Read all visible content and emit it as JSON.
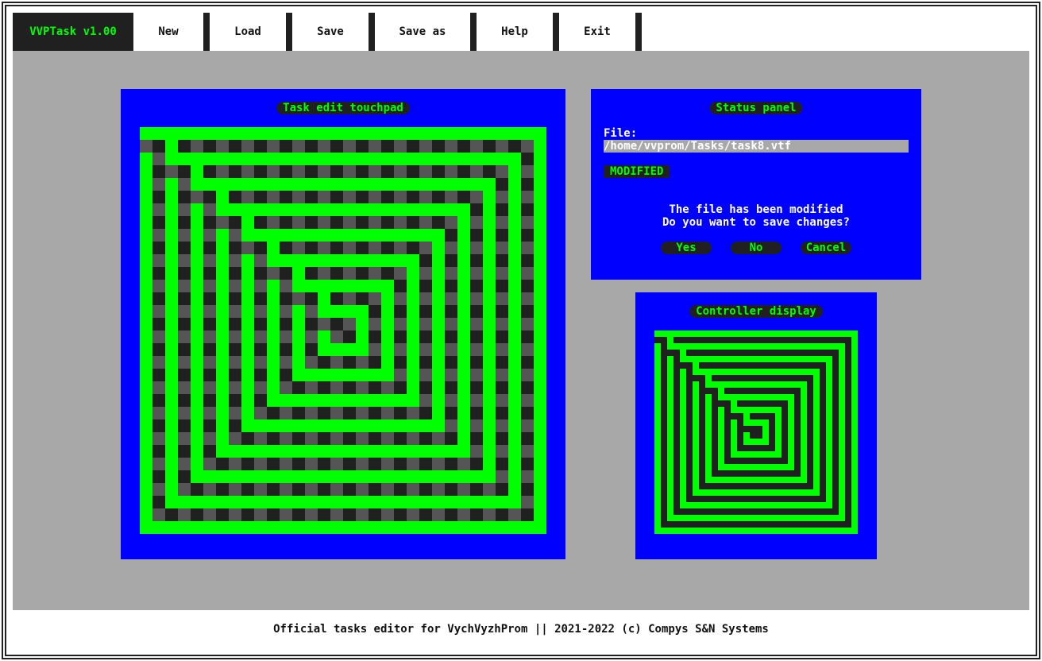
{
  "app": {
    "title": "VVPTask v1.00"
  },
  "menu": {
    "items": [
      "New",
      "Load",
      "Save",
      "Save as",
      "Help",
      "Exit"
    ]
  },
  "editor_panel": {
    "title": "Task edit touchpad"
  },
  "status_panel": {
    "title": "Status panel",
    "file_label": "File:",
    "file_path": "/home/vvprom/Tasks/task8.vtf",
    "state_badge": "MODIFIED",
    "message_line1": "The file has been modified",
    "message_line2": "Do you want to save changes?",
    "buttons": {
      "yes": "Yes",
      "no": "No",
      "cancel": "Cancel"
    }
  },
  "controller_panel": {
    "title": "Controller display"
  },
  "footer": {
    "text": "Official tasks editor for VychVyzhProm || 2021-2022 (c) Compys S&N Systems"
  },
  "colors": {
    "accent_green": "#00ff00",
    "panel_blue": "#0000ff",
    "workspace_gray": "#a8a8a8",
    "dark": "#202020"
  }
}
